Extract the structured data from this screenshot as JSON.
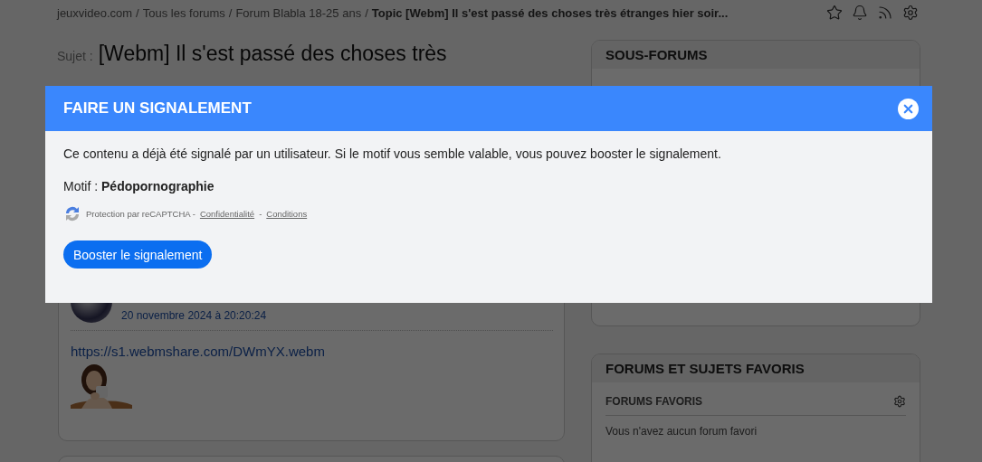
{
  "breadcrumb": {
    "items": [
      "jeuxvideo.com",
      "Tous les forums",
      "Forum Blabla 18-25 ans"
    ],
    "separator": "/",
    "current": "Topic [Webm] Il s'est passé des choses très étranges hier soir..."
  },
  "topic": {
    "label": "Sujet :",
    "title": "[Webm] Il s'est passé des choses très"
  },
  "post": {
    "date": "20 novembre 2024 à 20:20:24",
    "link": "https://s1.webmshare.com/DWmYX.webm"
  },
  "subforums": {
    "title": "SOUS-FORUMS"
  },
  "favorites": {
    "title": "FORUMS ET SUJETS FAVORIS",
    "section": "FORUMS FAVORIS",
    "empty": "Vous n'avez aucun forum favori"
  },
  "modal": {
    "title": "FAIRE UN SIGNALEMENT",
    "message": "Ce contenu a déjà été signalé par un utilisateur. Si le motif vous semble valable, vous pouvez booster le signalement.",
    "motif_label": "Motif :",
    "motif": "Pédopornographie",
    "recaptcha": "Protection par reCAPTCHA -",
    "links": [
      "Confidentialité",
      "Conditions"
    ],
    "separator": "-",
    "button": "Booster le signalement"
  }
}
